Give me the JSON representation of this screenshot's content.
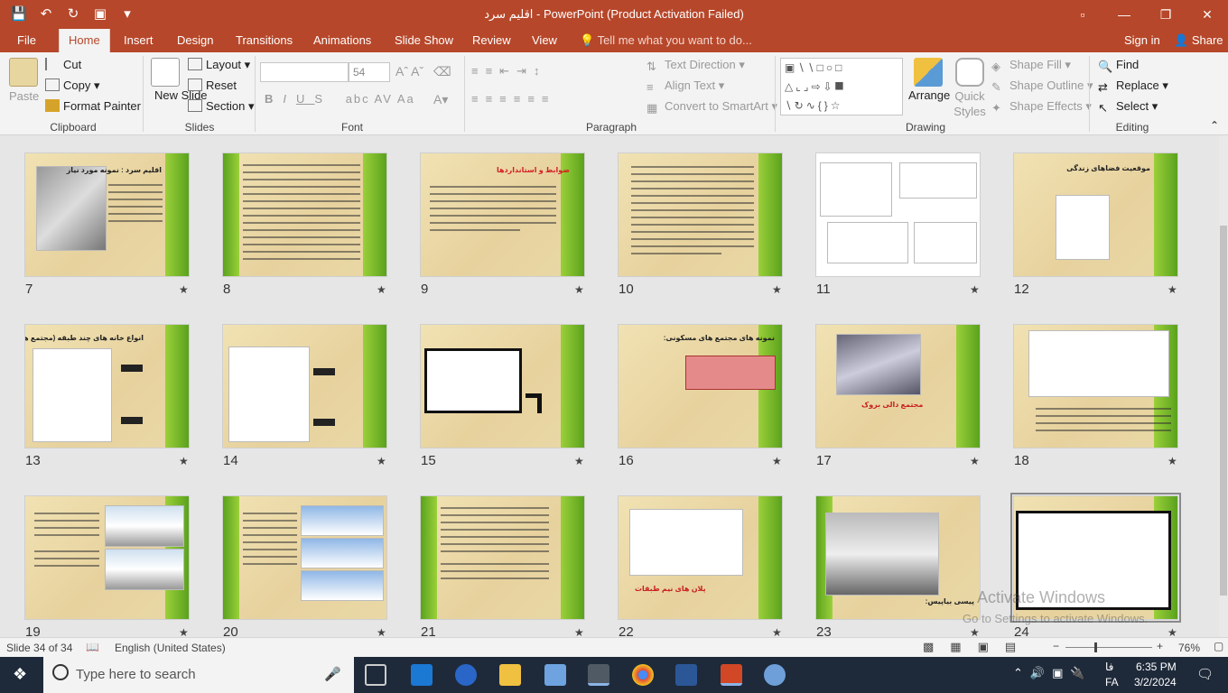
{
  "window": {
    "title": "اقلیم سرد - PowerPoint (Product Activation Failed)"
  },
  "tabs": [
    "File",
    "Home",
    "Insert",
    "Design",
    "Transitions",
    "Animations",
    "Slide Show",
    "Review",
    "View"
  ],
  "active_tab": "Home",
  "tell_me": "Tell me what you want to do...",
  "account": {
    "signin": "Sign in",
    "share": "Share"
  },
  "ribbon": {
    "clipboard": {
      "label": "Clipboard",
      "paste": "Paste",
      "cut": "Cut",
      "copy": "Copy",
      "format_painter": "Format Painter"
    },
    "slides": {
      "label": "Slides",
      "new_slide": "New Slide",
      "layout": "Layout",
      "reset": "Reset",
      "section": "Section"
    },
    "font": {
      "label": "Font",
      "font_name": "",
      "font_size": "54"
    },
    "paragraph": {
      "label": "Paragraph",
      "text_direction": "Text Direction",
      "align_text": "Align Text",
      "convert_smartart": "Convert to SmartArt"
    },
    "drawing": {
      "label": "Drawing",
      "arrange": "Arrange",
      "quick_styles": "Quick Styles",
      "shape_fill": "Shape Fill",
      "shape_outline": "Shape Outline",
      "shape_effects": "Shape Effects"
    },
    "editing": {
      "label": "Editing",
      "find": "Find",
      "replace": "Replace",
      "select": "Select"
    }
  },
  "slides": [
    {
      "num": "7",
      "title": "اقلیم سرد : نمونه مورد نیاز"
    },
    {
      "num": "8",
      "title": ""
    },
    {
      "num": "9",
      "title": "ضوابط و استانداردها"
    },
    {
      "num": "10",
      "title": ""
    },
    {
      "num": "11",
      "title": ""
    },
    {
      "num": "12",
      "title": "موقعیت فضاهای زندگی"
    },
    {
      "num": "13",
      "title": "انواع خانه های چند طبقه (مجتمع ها)"
    },
    {
      "num": "14",
      "title": ""
    },
    {
      "num": "15",
      "title": ""
    },
    {
      "num": "16",
      "title": "نمونه های مجتمع های مسکونی:"
    },
    {
      "num": "17",
      "title": "مجتمع دالی بروک"
    },
    {
      "num": "18",
      "title": ""
    },
    {
      "num": "19",
      "title": ""
    },
    {
      "num": "20",
      "title": ""
    },
    {
      "num": "21",
      "title": ""
    },
    {
      "num": "22",
      "title": "پلان های نیم طبقات"
    },
    {
      "num": "23",
      "title": "پیسی بیاپیس:"
    },
    {
      "num": "24",
      "title": ""
    }
  ],
  "activation": {
    "line1": "Activate Windows",
    "line2": "Go to Settings to activate Windows."
  },
  "status": {
    "slide_info": "Slide 34 of 34",
    "language": "English (United States)",
    "zoom": "76%"
  },
  "taskbar": {
    "search_placeholder": "Type here to search",
    "lang": "فا",
    "lang2": "FA",
    "time": "6:35 PM",
    "date": "3/2/2024"
  }
}
